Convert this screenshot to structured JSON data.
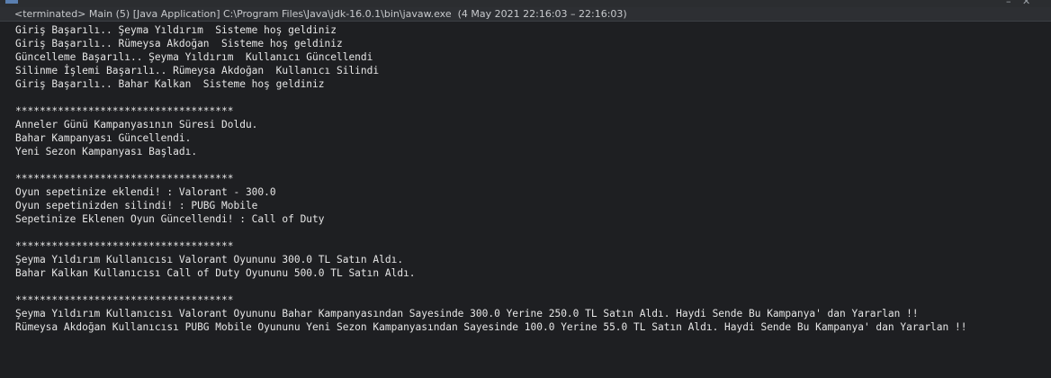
{
  "window": {
    "header": "<terminated> Main (5) [Java Application] C:\\Program Files\\Java\\jdk-16.0.1\\bin\\javaw.exe  (4 May 2021 22:16:03 – 22:16:03)",
    "controls": [
      "–",
      "✕"
    ]
  },
  "console": {
    "lines": [
      "Giriş Başarılı.. Şeyma Yıldırım  Sisteme hoş geldiniz",
      "Giriş Başarılı.. Rümeysa Akdoğan  Sisteme hoş geldiniz",
      "Güncelleme Başarılı.. Şeyma Yıldırım  Kullanıcı Güncellendi",
      "Silinme İşlemi Başarılı.. Rümeysa Akdoğan  Kullanıcı Silindi",
      "Giriş Başarılı.. Bahar Kalkan  Sisteme hoş geldiniz",
      "",
      "************************************",
      "Anneler Günü Kampanyasının Süresi Doldu.",
      "Bahar Kampanyası Güncellendi.",
      "Yeni Sezon Kampanyası Başladı.",
      "",
      "************************************",
      "Oyun sepetinize eklendi! : Valorant - 300.0",
      "Oyun sepetinizden silindi! : PUBG Mobile",
      "Sepetinize Eklenen Oyun Güncellendi! : Call of Duty",
      "",
      "************************************",
      "Şeyma Yıldırım Kullanıcısı Valorant Oyununu 300.0 TL Satın Aldı.",
      "Bahar Kalkan Kullanıcısı Call of Duty Oyununu 500.0 TL Satın Aldı.",
      "",
      "************************************",
      "Şeyma Yıldırım Kullanıcısı Valorant Oyununu Bahar Kampanyasından Sayesinde 300.0 Yerine 250.0 TL Satın Aldı. Haydi Sende Bu Kampanya' dan Yararlan !!",
      "Rümeysa Akdoğan Kullanıcısı PUBG Mobile Oyununu Yeni Sezon Kampanyasından Sayesinde 100.0 Yerine 55.0 TL Satın Aldı. Haydi Sende Bu Kampanya' dan Yararlan !!"
    ]
  },
  "colors": {
    "background": "#1e1f22",
    "header_background": "#2d2f33",
    "text": "#e6e6e6"
  }
}
